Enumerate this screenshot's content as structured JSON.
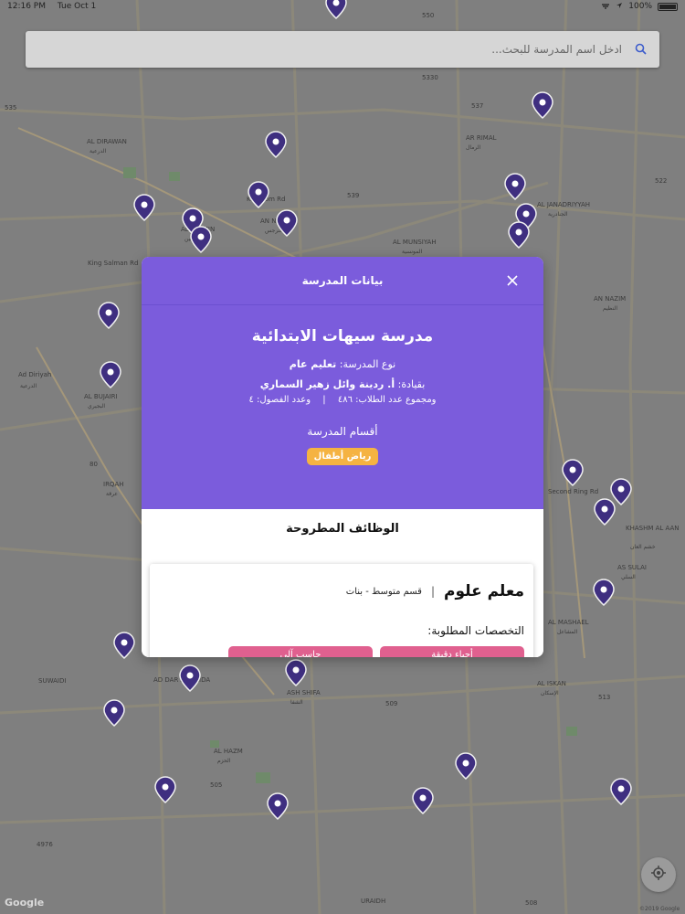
{
  "status_bar": {
    "time": "12:16 PM",
    "date": "Tue Oct 1",
    "battery": "100%",
    "battery_level": 1.0
  },
  "search": {
    "placeholder": "ادخل اسم المدرسة للبحث..."
  },
  "modal": {
    "header": "بيانات المدرسة",
    "school_name": "مدرسة سيهات الابتدائية",
    "type_label": "نوع المدرسة:",
    "type_value": "تعليم عام",
    "leader_label": "بقيادة:",
    "leader_value": "أ. ردينة وائل زهير السماري",
    "students_label": "ومجموع عدد الطلاب:",
    "students_value": "٤٨٦",
    "classes_label": "وعدد الفصول:",
    "classes_value": "٤",
    "stats_separator": "|",
    "sections_title": "أقسام المدرسة",
    "sections": [
      "رياض أطفال"
    ],
    "jobs_title": "الوظائف المطروحة",
    "job": {
      "title": "معلم علوم",
      "separator": "|",
      "department": "قسم متوسط - بنات",
      "requirements_title": "التخصصات المطلوبة:",
      "tags": [
        "أحياء دقيقة",
        "حاسب آلي"
      ]
    },
    "colors": {
      "primary": "#7b5cdc",
      "chip": "#f5b342",
      "tag": "#e0608f"
    }
  },
  "map": {
    "google_logo": "Google",
    "copyright": "©2019 Google",
    "labels": [
      "AL DIRAWAN",
      "AL YASMIN",
      "AN NARJIS",
      "AL MUNSIYAH",
      "AL JANADRIYYAH",
      "AN NAZIM",
      "Ad Diriyah",
      "AL BUJAIRI",
      "IRQAH",
      "KHASHM AL AAN",
      "AS SULAI",
      "AL MASHAEL",
      "AD DAR AL BAIDA",
      "AL ISKAN",
      "ASH SHIFA",
      "AL HAZM",
      "SUWAIDI",
      "URAIDH",
      "AR RIMAL",
      "King Salman Rd",
      "Kingdom Rd",
      "Second Ring Rd",
      "535",
      "550",
      "5330",
      "537",
      "539",
      "522",
      "80",
      "509",
      "505",
      "508",
      "513",
      "4976"
    ],
    "labels_ar": [
      "الدرعية",
      "البجيري",
      "النرجس",
      "الياسمين",
      "الرمال",
      "المونسية",
      "الجنادرية",
      "النظيم",
      "خشم العان",
      "السلي",
      "المشاعل",
      "الإسكان",
      "الشفا",
      "الحزم",
      "عرقة"
    ]
  }
}
